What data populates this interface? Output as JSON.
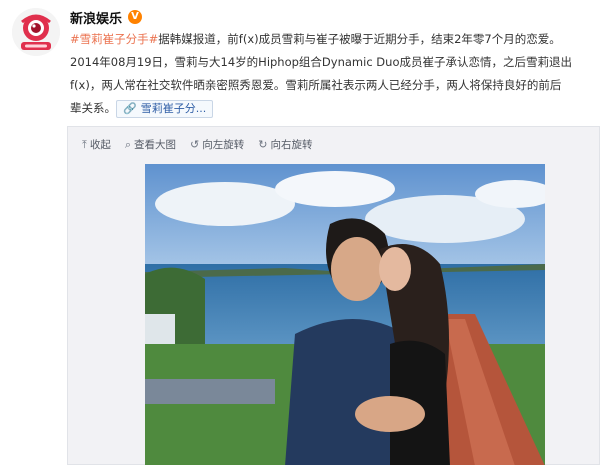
{
  "account": {
    "name": "新浪娱乐",
    "verified_badge": "V",
    "avatar_icon": "sina-eye-logo"
  },
  "post": {
    "hashtag": "#雪莉崔子分手#",
    "line1_rest": "据韩媒报道，前f(x)成员雪莉与崔子被曝于近期分手，结束2年零7个月的恋爱。",
    "line2": "2014年08月19日，雪莉与大14岁的Hiphop组合Dynamic Duo成员崔子承认恋情，之后雪莉退出",
    "line3": "f(x)，两人常在社交软件晒亲密照秀恩爱。雪莉所属社表示两人已经分手，两人将保持良好的前后",
    "line4_start": "辈关系。",
    "topic_tag": "雪莉崔子分..."
  },
  "media_toolbar": {
    "collapse": "收起",
    "view_large": "查看大图",
    "rotate_left": "向左旋转",
    "rotate_right": "向右旋转"
  },
  "colors": {
    "hashtag": "#eb7350",
    "link": "#2f5ea6",
    "verified": "#ff8200"
  }
}
